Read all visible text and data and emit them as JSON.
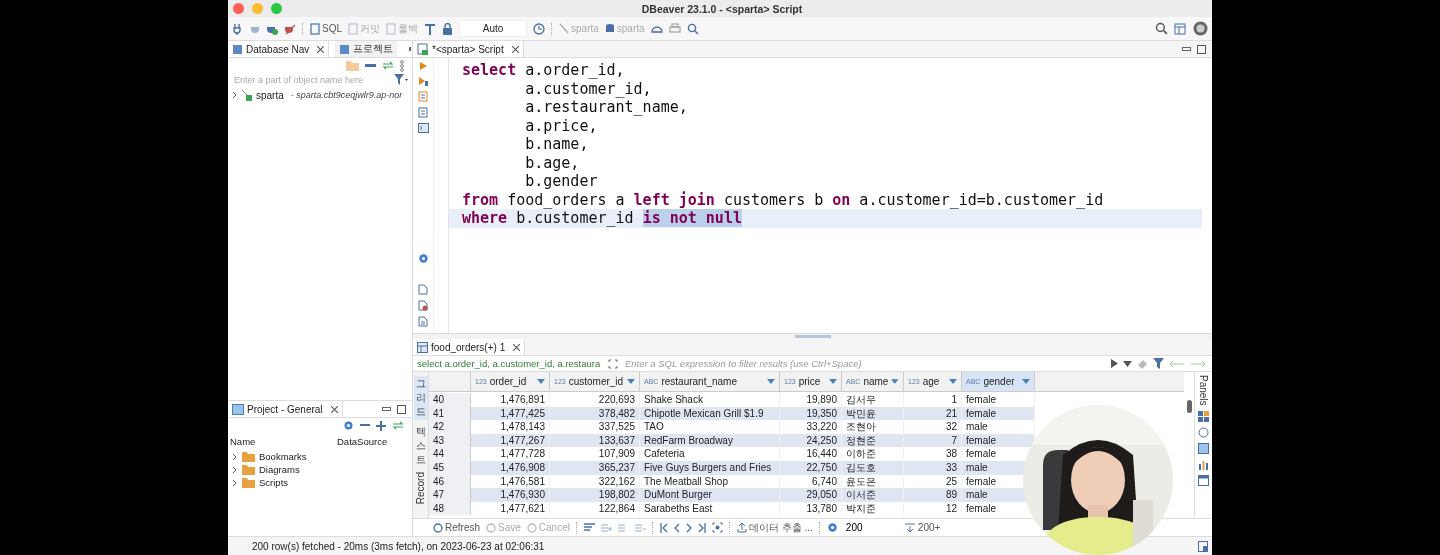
{
  "window": {
    "title": "DBeaver 23.1.0 - <sparta> Script"
  },
  "toolbar": {
    "items": [
      {
        "label": "SQL",
        "disabled": false
      },
      {
        "label": "커밋",
        "disabled": true
      },
      {
        "label": "롤백",
        "disabled": true
      }
    ],
    "transaction_mode": "Auto",
    "datasource": "sparta",
    "schema": "sparta"
  },
  "navigator": {
    "tabs": [
      {
        "label": "Database Nav",
        "selected": true,
        "closable": true
      },
      {
        "label": "프로젝트",
        "selected": false,
        "closable": false
      }
    ],
    "filter_placeholder": "Enter a part of object name here",
    "tree": [
      {
        "name": "sparta",
        "detail": "- sparta.cbt9ceqjwlr9.ap-nor",
        "expanded": false
      }
    ]
  },
  "project": {
    "tab": "Project - General",
    "columns": [
      "Name",
      "DataSource"
    ],
    "items": [
      {
        "name": "Bookmarks",
        "expanded": false
      },
      {
        "name": "Diagrams",
        "expanded": false
      },
      {
        "name": "Scripts",
        "expanded": false
      }
    ]
  },
  "editor": {
    "tab": "*<sparta> Script",
    "lines": [
      {
        "current": false,
        "tokens": [
          {
            "text": "select",
            "kind": "keyword",
            "selected": false
          },
          {
            "text": " a.order_id,",
            "kind": "plain",
            "selected": false
          }
        ]
      },
      {
        "current": false,
        "tokens": [
          {
            "text": "       a.customer_id,",
            "kind": "plain",
            "selected": false
          }
        ]
      },
      {
        "current": false,
        "tokens": [
          {
            "text": "       a.restaurant_name,",
            "kind": "plain",
            "selected": false
          }
        ]
      },
      {
        "current": false,
        "tokens": [
          {
            "text": "       a.price,",
            "kind": "plain",
            "selected": false
          }
        ]
      },
      {
        "current": false,
        "tokens": [
          {
            "text": "       b.name,",
            "kind": "plain",
            "selected": false
          }
        ]
      },
      {
        "current": false,
        "tokens": [
          {
            "text": "       b.age,",
            "kind": "plain",
            "selected": false
          }
        ]
      },
      {
        "current": false,
        "tokens": [
          {
            "text": "       b.gender",
            "kind": "plain",
            "selected": false
          }
        ]
      },
      {
        "current": false,
        "tokens": [
          {
            "text": "from",
            "kind": "keyword",
            "selected": false
          },
          {
            "text": " food_orders a ",
            "kind": "plain",
            "selected": false
          },
          {
            "text": "left join",
            "kind": "keyword",
            "selected": false
          },
          {
            "text": " customers b ",
            "kind": "plain",
            "selected": false
          },
          {
            "text": "on",
            "kind": "keyword",
            "selected": false
          },
          {
            "text": " a.customer_id=b.customer_id",
            "kind": "plain",
            "selected": false
          }
        ]
      },
      {
        "current": true,
        "tokens": [
          {
            "text": "where",
            "kind": "keyword",
            "selected": false
          },
          {
            "text": " b.customer_id ",
            "kind": "plain",
            "selected": false
          },
          {
            "text": "is not null",
            "kind": "keyword",
            "selected": true
          }
        ]
      }
    ]
  },
  "results": {
    "tab": "food_orders(+) 1",
    "query": "select a.order_id, a.customer_id, a.restaura",
    "filter_placeholder": "Enter a SQL expression to filter results (use Ctrl+Space)",
    "side_tabs": [
      {
        "label": "그리드",
        "selected": true
      },
      {
        "label": "텍스트",
        "selected": false
      }
    ],
    "record_label": "Record",
    "panels_label": "Panels",
    "columns": [
      {
        "name": "order_id",
        "type": "123",
        "selected": false
      },
      {
        "name": "customer_id",
        "type": "123",
        "selected": false
      },
      {
        "name": "restaurant_name",
        "type": "ABC",
        "selected": false
      },
      {
        "name": "price",
        "type": "123",
        "selected": false
      },
      {
        "name": "name",
        "type": "ABC",
        "selected": false
      },
      {
        "name": "age",
        "type": "123",
        "selected": false
      },
      {
        "name": "gender",
        "type": "ABC",
        "selected": true
      }
    ],
    "rows": [
      {
        "num": "40",
        "cells": [
          "1,476,891",
          "220,693",
          "Shake Shack",
          "19,890",
          "김서우",
          "1",
          "female"
        ]
      },
      {
        "num": "41",
        "cells": [
          "1,477,425",
          "378,482",
          "Chipotle Mexican Grill $1.9",
          "19,350",
          "박민윤",
          "21",
          "female"
        ]
      },
      {
        "num": "42",
        "cells": [
          "1,478,143",
          "337,525",
          "TAO",
          "33,220",
          "조현아",
          "32",
          "male"
        ]
      },
      {
        "num": "43",
        "cells": [
          "1,477,267",
          "133,637",
          "RedFarm Broadway",
          "24,250",
          "정현준",
          "7",
          "female"
        ]
      },
      {
        "num": "44",
        "cells": [
          "1,477,728",
          "107,909",
          "Cafeteria",
          "16,440",
          "이하준",
          "38",
          "female"
        ]
      },
      {
        "num": "45",
        "cells": [
          "1,476,908",
          "365,237",
          "Five Guys Burgers and Fries",
          "22,750",
          "김도호",
          "33",
          "male"
        ]
      },
      {
        "num": "46",
        "cells": [
          "1,476,581",
          "322,162",
          "The Meatball Shop",
          "6,740",
          "윤도은",
          "25",
          "female"
        ]
      },
      {
        "num": "47",
        "cells": [
          "1,476,930",
          "198,802",
          "DuMont Burger",
          "29,050",
          "이서준",
          "89",
          "male"
        ]
      },
      {
        "num": "48",
        "cells": [
          "1,477,621",
          "122,864",
          "Sarabeths East",
          "13,780",
          "박지준",
          "12",
          "female"
        ]
      }
    ],
    "buttons": [
      {
        "label": "Refresh",
        "disabled": false
      },
      {
        "label": "Save",
        "disabled": true
      },
      {
        "label": "Cancel",
        "disabled": true
      }
    ],
    "export_label": "데이터 추출 ...",
    "fetch_size": "200",
    "row_count": "200+"
  },
  "status_bar": "200 row(s) fetched - 20ms (3ms fetch), on 2023-06-23 at 02:06:31"
}
